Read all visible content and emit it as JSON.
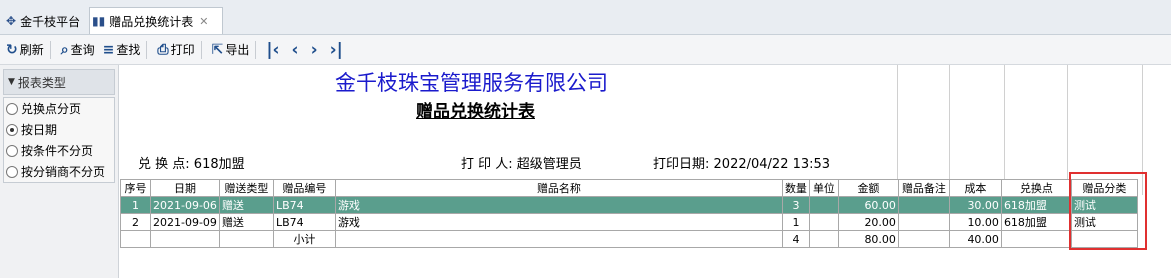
{
  "tabs": [
    {
      "label": "金千枝平台",
      "icon": "platform-icon"
    },
    {
      "label": "赠品兑换统计表",
      "icon": "report-icon"
    }
  ],
  "toolbar": {
    "refresh": "刷新",
    "query": "查询",
    "find": "查找",
    "print": "打印",
    "export": "导出"
  },
  "sidebar": {
    "header": "报表类型",
    "options": [
      {
        "label": "兑换点分页",
        "selected": false
      },
      {
        "label": "按日期",
        "selected": true
      },
      {
        "label": "按条件不分页",
        "selected": false
      },
      {
        "label": "按分销商不分页",
        "selected": false
      }
    ]
  },
  "report": {
    "company": "金千枝珠宝管理服务有限公司",
    "title": "赠品兑换统计表",
    "info": {
      "point_label": "兑 换 点:",
      "point_value": "618加盟",
      "printer_label": "打 印 人:",
      "printer_value": "超级管理员",
      "date_label": "打印日期:",
      "date_value": "2022/04/22 13:53"
    },
    "columns": [
      "序号",
      "日期",
      "赠送类型",
      "赠品编号",
      "赠品名称",
      "数量",
      "单位",
      "金额",
      "赠品备注",
      "成本",
      "兑换点",
      "赠品分类"
    ],
    "rows": [
      {
        "no": "1",
        "date": "2021-09-06",
        "type": "赠送",
        "code": "LB74",
        "name": "游戏",
        "qty": "3",
        "unit": "",
        "amount": "60.00",
        "remark": "",
        "cost": "30.00",
        "point": "618加盟",
        "category": "测试"
      },
      {
        "no": "2",
        "date": "2021-09-09",
        "type": "赠送",
        "code": "LB74",
        "name": "游戏",
        "qty": "1",
        "unit": "",
        "amount": "20.00",
        "remark": "",
        "cost": "10.00",
        "point": "618加盟",
        "category": "测试"
      }
    ],
    "subtotal": {
      "label": "小计",
      "qty": "4",
      "amount": "80.00",
      "cost": "40.00"
    }
  },
  "colors": {
    "selected_row": "#5a9e8d",
    "highlight_box": "#e03030",
    "company_text": "#1a1acc"
  }
}
